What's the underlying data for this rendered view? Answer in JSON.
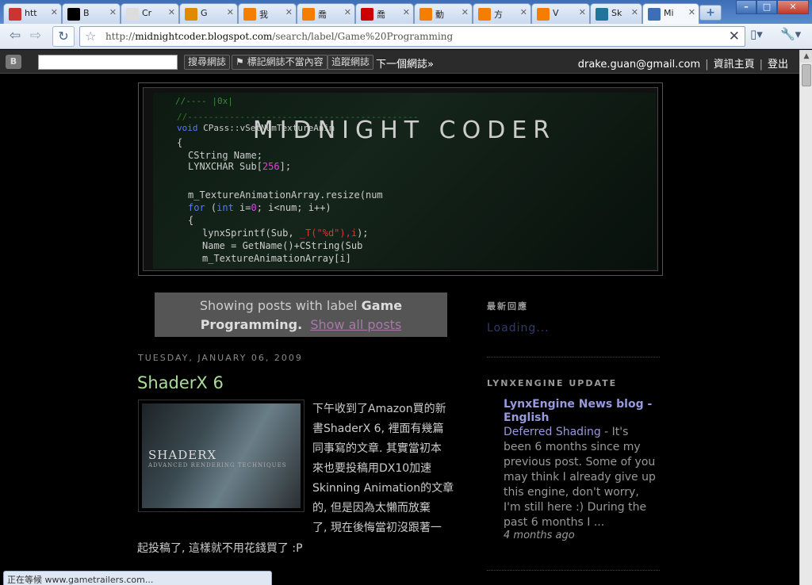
{
  "tabs": [
    {
      "title": "htt",
      "icon": "zc-favicon-icon",
      "color": "#cc3333"
    },
    {
      "title": "B",
      "icon": "yin-yang-favicon-icon",
      "color": "#000000"
    },
    {
      "title": "Cr",
      "icon": "page-favicon-icon",
      "color": "#dddddd"
    },
    {
      "title": "G",
      "icon": "rss-favicon-icon",
      "color": "#e08a00"
    },
    {
      "title": "我",
      "icon": "blogger-favicon-icon",
      "color": "#f57d00"
    },
    {
      "title": "喬",
      "icon": "blogger-favicon-icon",
      "color": "#f57d00"
    },
    {
      "title": "喬",
      "icon": "yahoo-favicon-icon",
      "color": "#cc0000"
    },
    {
      "title": "動",
      "icon": "blogger-favicon-icon",
      "color": "#f57d00"
    },
    {
      "title": "方",
      "icon": "blogger-favicon-icon",
      "color": "#f57d00"
    },
    {
      "title": "V",
      "icon": "blogger-favicon-icon",
      "color": "#f57d00"
    },
    {
      "title": "Sk",
      "icon": "wordpress-favicon-icon",
      "color": "#21759b"
    },
    {
      "title": "Mi",
      "icon": "loading-favicon-icon",
      "color": "#3d6fb6",
      "active": true
    }
  ],
  "toolbar": {
    "url_prefix": "http://",
    "url_host": "midnightcoder.blogspot.com",
    "url_path": "/search/label/Game%20Programming"
  },
  "navbar": {
    "search_value": "",
    "search_blog": "搜尋網誌",
    "flag_blog": "標記網誌不當內容",
    "follow_blog": "追蹤網誌",
    "next_blog": "下一個網誌»",
    "user_email": "drake.guan@gmail.com",
    "dashboard": "資訊主頁",
    "sign_out": "登出"
  },
  "header": {
    "title": "MIDNIGHT CODER"
  },
  "label_box": {
    "prefix": "Showing posts with label",
    "label_part1": "Game",
    "label_part2": "Programming.",
    "show_all": "Show all posts"
  },
  "post": {
    "date": "TUESDAY, JANUARY 06, 2009",
    "title": "ShaderX 6",
    "lines": [
      "下午收到了Amazon買的新",
      "書ShaderX 6, 裡面有幾篇",
      "同事寫的文章. 其實當初本",
      "來也要投稿用DX10加速",
      "Skinning Animation的文章",
      "的, 但是因為太懶而放棄",
      "了, 現在後悔當初沒跟著一"
    ],
    "line_last": "起投稿了, 這樣就不用花錢買了 :P",
    "image_book_title": "SHADERX",
    "image_book_sub": "ADVANCED RENDERING TECHNIQUES"
  },
  "sidebar": {
    "recent_comments_heading": "最新回應",
    "loading": "Loading...",
    "update_heading": "LYNXENGINE UPDATE",
    "feed_title": "LynxEngine News blog - English",
    "feed_link": "Deferred Shading",
    "feed_snippet": " - It's been 6 months since my previous post. Some of you may think I already give up this engine, don't worry, I'm still here :) During the past 6 months I ...",
    "feed_time": "4 months ago"
  },
  "status_bar": {
    "text": "正在等候 www.gametrailers.com..."
  }
}
